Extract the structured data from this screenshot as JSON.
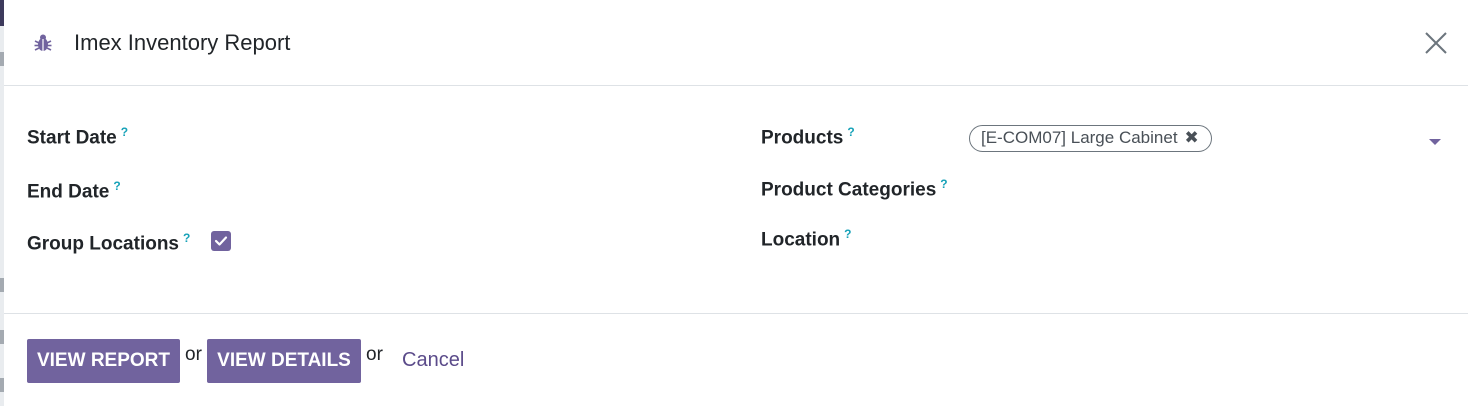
{
  "dialog": {
    "title": "Imex Inventory Report",
    "icons": {
      "debug": "bug-icon",
      "close": "close-icon"
    }
  },
  "form": {
    "left": [
      {
        "label": "Start Date",
        "help": "?"
      },
      {
        "label": "End Date",
        "help": "?"
      },
      {
        "label": "Group Locations",
        "help": "?",
        "checked": true
      }
    ],
    "right": [
      {
        "label": "Products",
        "help": "?",
        "tags": [
          "[E-COM07] Large Cabinet"
        ]
      },
      {
        "label": "Product Categories",
        "help": "?"
      },
      {
        "label": "Location",
        "help": "?"
      }
    ]
  },
  "footer": {
    "view_report": "VIEW REPORT",
    "or1": "or",
    "view_details": "VIEW DETAILS",
    "or2": "or",
    "cancel": "Cancel"
  },
  "colors": {
    "primary": "#71639e",
    "help": "#17a2b8",
    "link": "#5b4b8a"
  }
}
